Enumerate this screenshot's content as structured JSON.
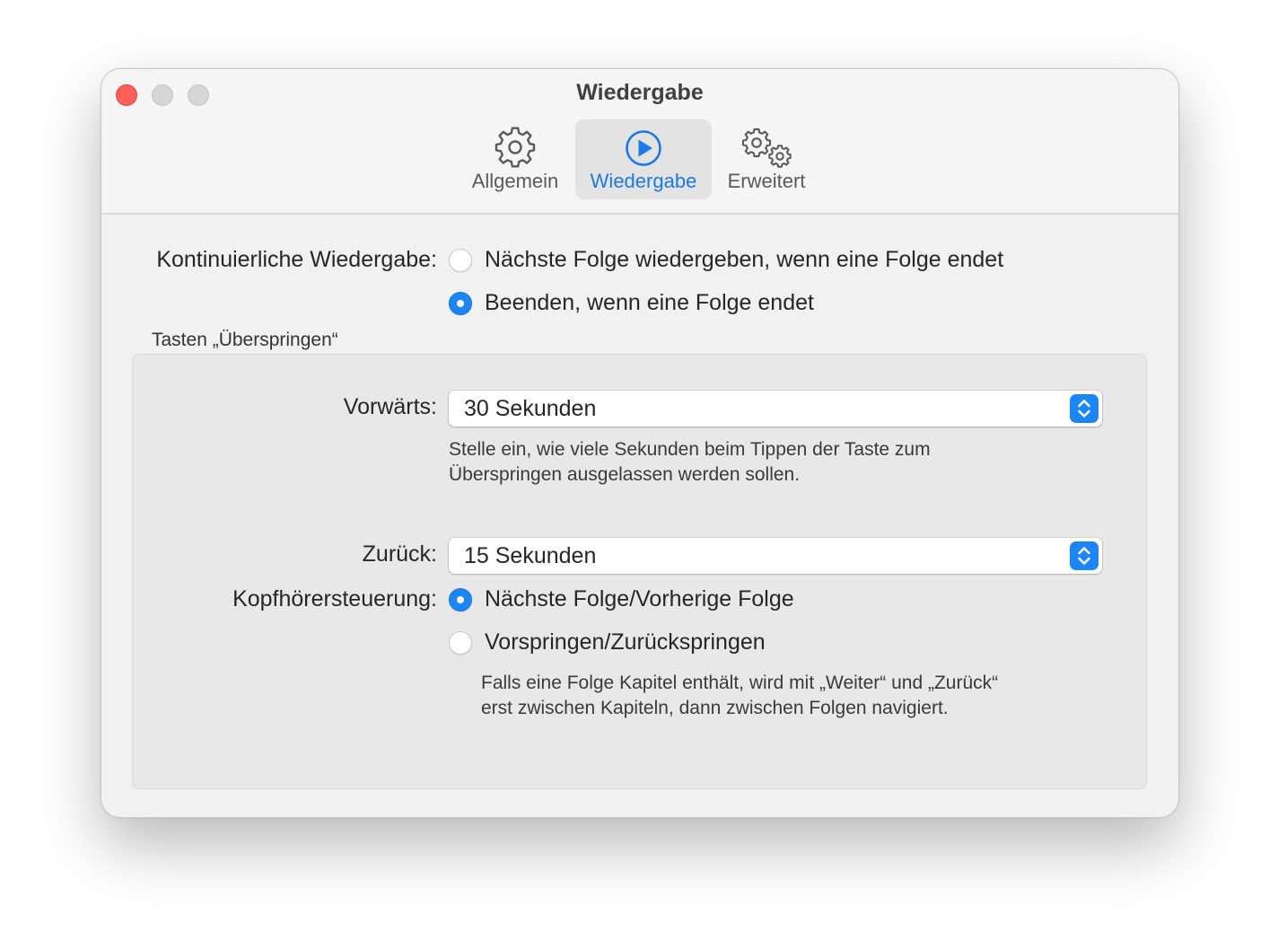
{
  "window": {
    "title": "Wiedergabe"
  },
  "toolbar": {
    "tabs": [
      {
        "label": "Allgemein",
        "icon": "gear-icon",
        "selected": false
      },
      {
        "label": "Wiedergabe",
        "icon": "play-circle-icon",
        "selected": true
      },
      {
        "label": "Erweitert",
        "icon": "double-gear-icon",
        "selected": false
      }
    ]
  },
  "continuous": {
    "label": "Kontinuierliche Wiedergabe:",
    "options": [
      {
        "label": "Nächste Folge wiedergeben, wenn eine Folge endet",
        "selected": false
      },
      {
        "label": "Beenden, wenn eine Folge endet",
        "selected": true
      }
    ]
  },
  "skip": {
    "group_title": "Tasten „Überspringen“",
    "forward_label": "Vorwärts:",
    "forward_value": "30 Sekunden",
    "forward_hint_1": "Stelle ein, wie viele Sekunden beim Tippen der Taste zum",
    "forward_hint_2": "Überspringen ausgelassen werden sollen.",
    "back_label": "Zurück:",
    "back_value": "15 Sekunden",
    "headphone_label": "Kopfhörersteuerung:",
    "headphone_options": [
      {
        "label": "Nächste Folge/Vorherige Folge",
        "selected": true
      },
      {
        "label": "Vorspringen/Zurückspringen",
        "selected": false
      }
    ],
    "headphone_hint_1": "Falls eine Folge Kapitel enthält, wird mit „Weiter“ und „Zurück“",
    "headphone_hint_2": "erst zwischen Kapiteln, dann zwischen Folgen navigiert."
  },
  "colors": {
    "accent": "#1d86f5",
    "close": "#fe5f57"
  }
}
